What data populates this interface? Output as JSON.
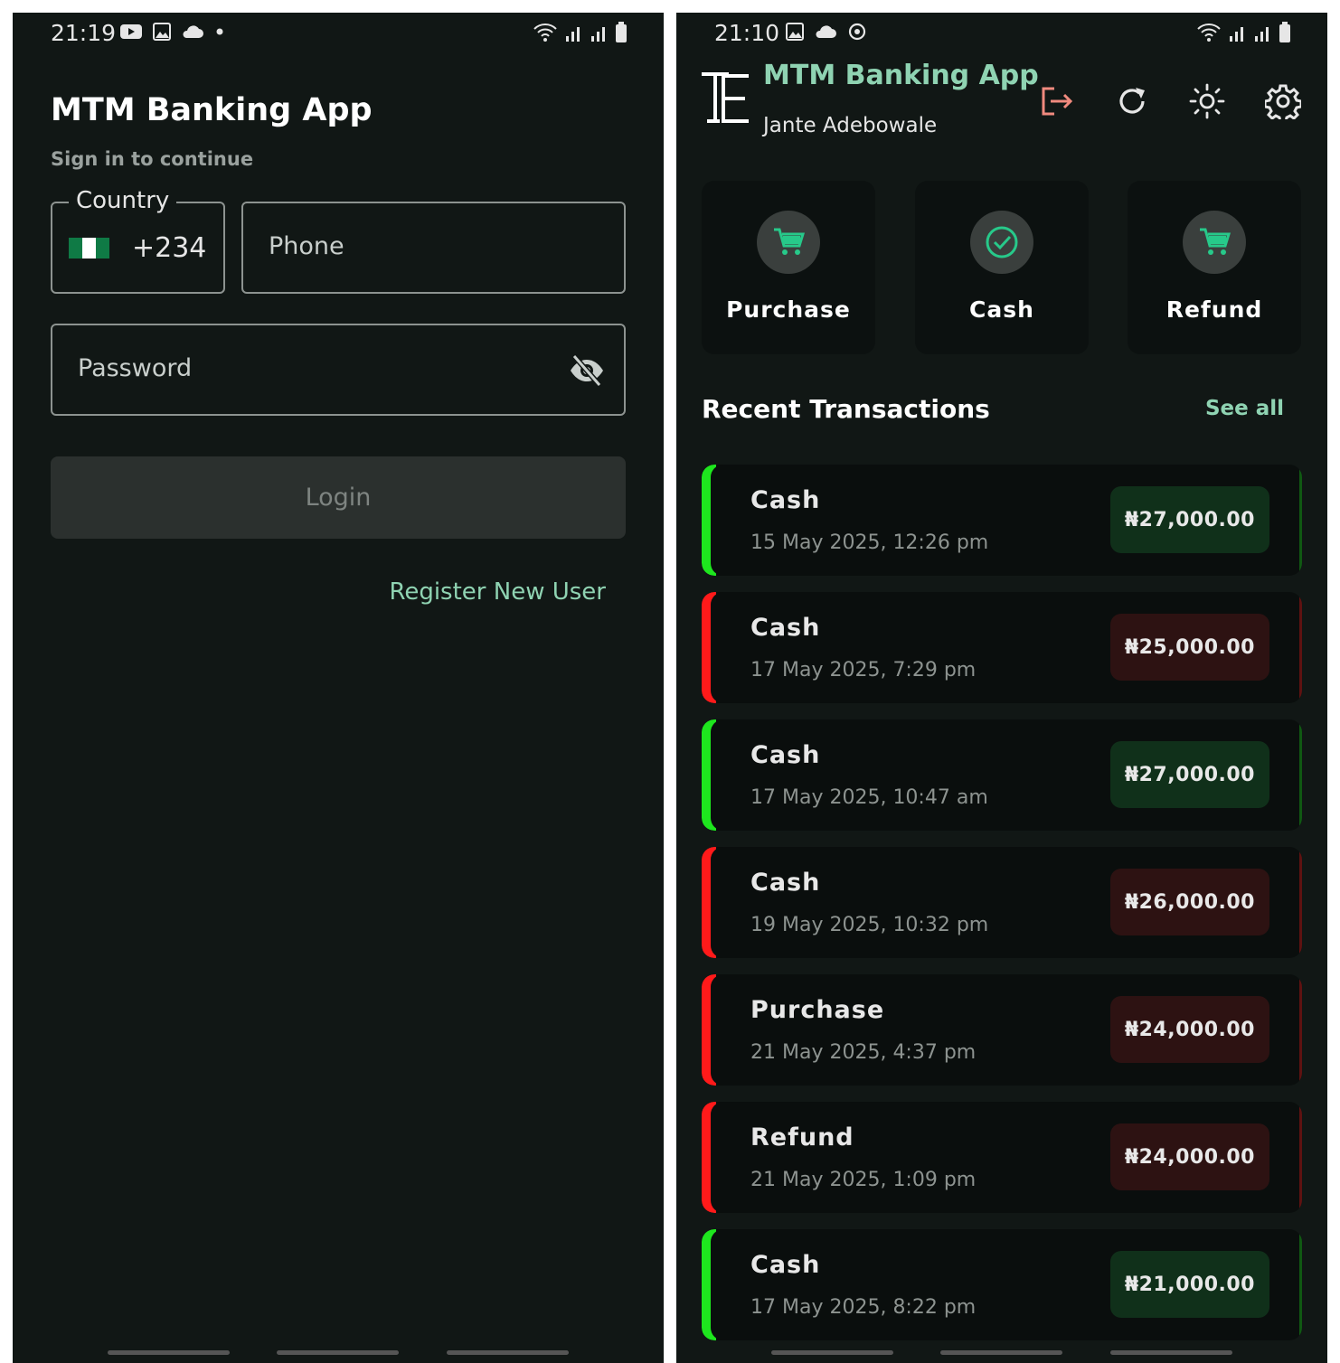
{
  "login_screen": {
    "status": {
      "time": "21:19",
      "notification_icons": [
        "youtube-icon",
        "gallery-icon",
        "cloud-icon",
        "dot-icon"
      ]
    },
    "title": "MTM Banking App",
    "subtitle": "Sign in to continue",
    "country": {
      "legend": "Country",
      "flag": "nigeria-flag",
      "dial_code": "+234"
    },
    "phone": {
      "placeholder": "Phone",
      "value": ""
    },
    "password": {
      "placeholder": "Password",
      "value": ""
    },
    "login_label": "Login",
    "register_label": "Register New User"
  },
  "home_screen": {
    "status": {
      "time": "21:10",
      "notification_icons": [
        "gallery-icon",
        "cloud-icon",
        "sync-icon"
      ]
    },
    "app_title": "MTM Banking App",
    "user_name": "Jante Adebowale",
    "header_icons": [
      "logout-icon",
      "refresh-icon",
      "brightness-icon",
      "settings-icon"
    ],
    "actions": [
      {
        "label": "Purchase",
        "icon": "cart-icon"
      },
      {
        "label": "Cash",
        "icon": "check-circle-icon"
      },
      {
        "label": "Refund",
        "icon": "cart-icon"
      }
    ],
    "recent_title": "Recent Transactions",
    "see_all": "See all",
    "transactions": [
      {
        "title": "Cash",
        "date": "15 May 2025, 12:26 pm",
        "amount": "₦27,000.00",
        "status": "credit"
      },
      {
        "title": "Cash",
        "date": "17 May 2025, 7:29 pm",
        "amount": "₦25,000.00",
        "status": "debit"
      },
      {
        "title": "Cash",
        "date": "17 May 2025, 10:47 am",
        "amount": "₦27,000.00",
        "status": "credit"
      },
      {
        "title": "Cash",
        "date": "19 May 2025, 10:32 pm",
        "amount": "₦26,000.00",
        "status": "debit"
      },
      {
        "title": "Purchase",
        "date": "21 May 2025, 4:37 pm",
        "amount": "₦24,000.00",
        "status": "debit"
      },
      {
        "title": "Refund",
        "date": "21 May 2025, 1:09 pm",
        "amount": "₦24,000.00",
        "status": "debit"
      },
      {
        "title": "Cash",
        "date": "17 May 2025, 8:22 pm",
        "amount": "₦21,000.00",
        "status": "credit"
      }
    ]
  },
  "colors": {
    "background": "#111715",
    "accent": "#8fd3b2",
    "credit": "#1ee61e",
    "debit": "#ff1a1a",
    "credit_badge": "#10301a",
    "debit_badge": "#2d1212"
  }
}
